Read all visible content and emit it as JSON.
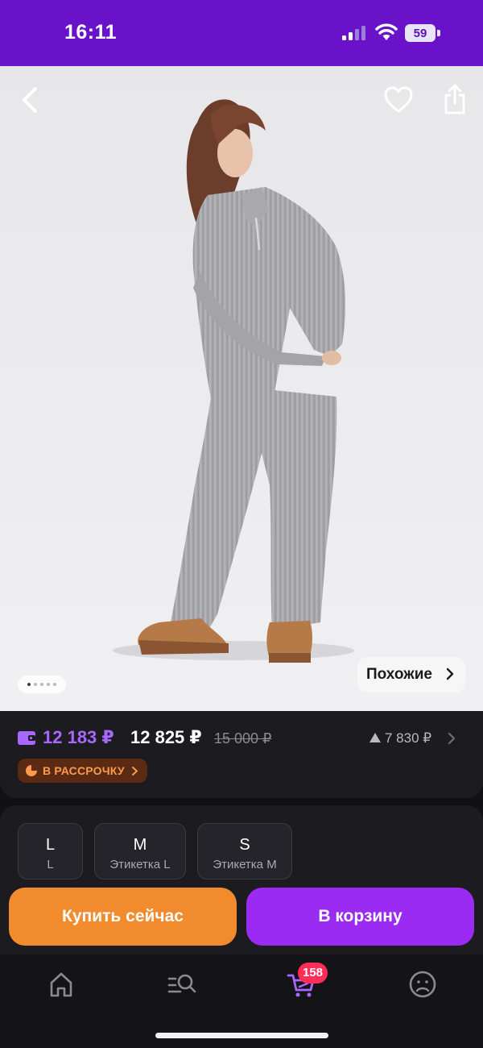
{
  "status_bar": {
    "time": "16:11",
    "battery": "59"
  },
  "product_page": {
    "gallery": {
      "dots_total": 5,
      "active_dot": 1,
      "similar_label": "Похожие"
    },
    "icons": {
      "back": "back-icon",
      "favorite": "heart-icon",
      "share": "share-icon"
    }
  },
  "price": {
    "card_price": "12 183 ₽",
    "price": "12 825 ₽",
    "old_price": "15 000 ₽",
    "points": "7 830 ₽",
    "installment_label": "В РАССРОЧКУ"
  },
  "sizes": [
    {
      "main": "L",
      "sub": "L"
    },
    {
      "main": "M",
      "sub": "Этикетка L"
    },
    {
      "main": "S",
      "sub": "Этикетка M"
    }
  ],
  "actions": {
    "buy_now": "Купить сейчас",
    "add_to_cart": "В корзину"
  },
  "bottom_nav": {
    "cart_badge": "158",
    "items": [
      "home-icon",
      "catalog-search-icon",
      "cart-icon",
      "profile-icon"
    ]
  },
  "colors": {
    "brand_purple": "#6a12c9",
    "accent_purple": "#9b2bf2",
    "accent_orange": "#f28a2e",
    "card_price": "#a868ff",
    "badge": "#ff2d57"
  }
}
